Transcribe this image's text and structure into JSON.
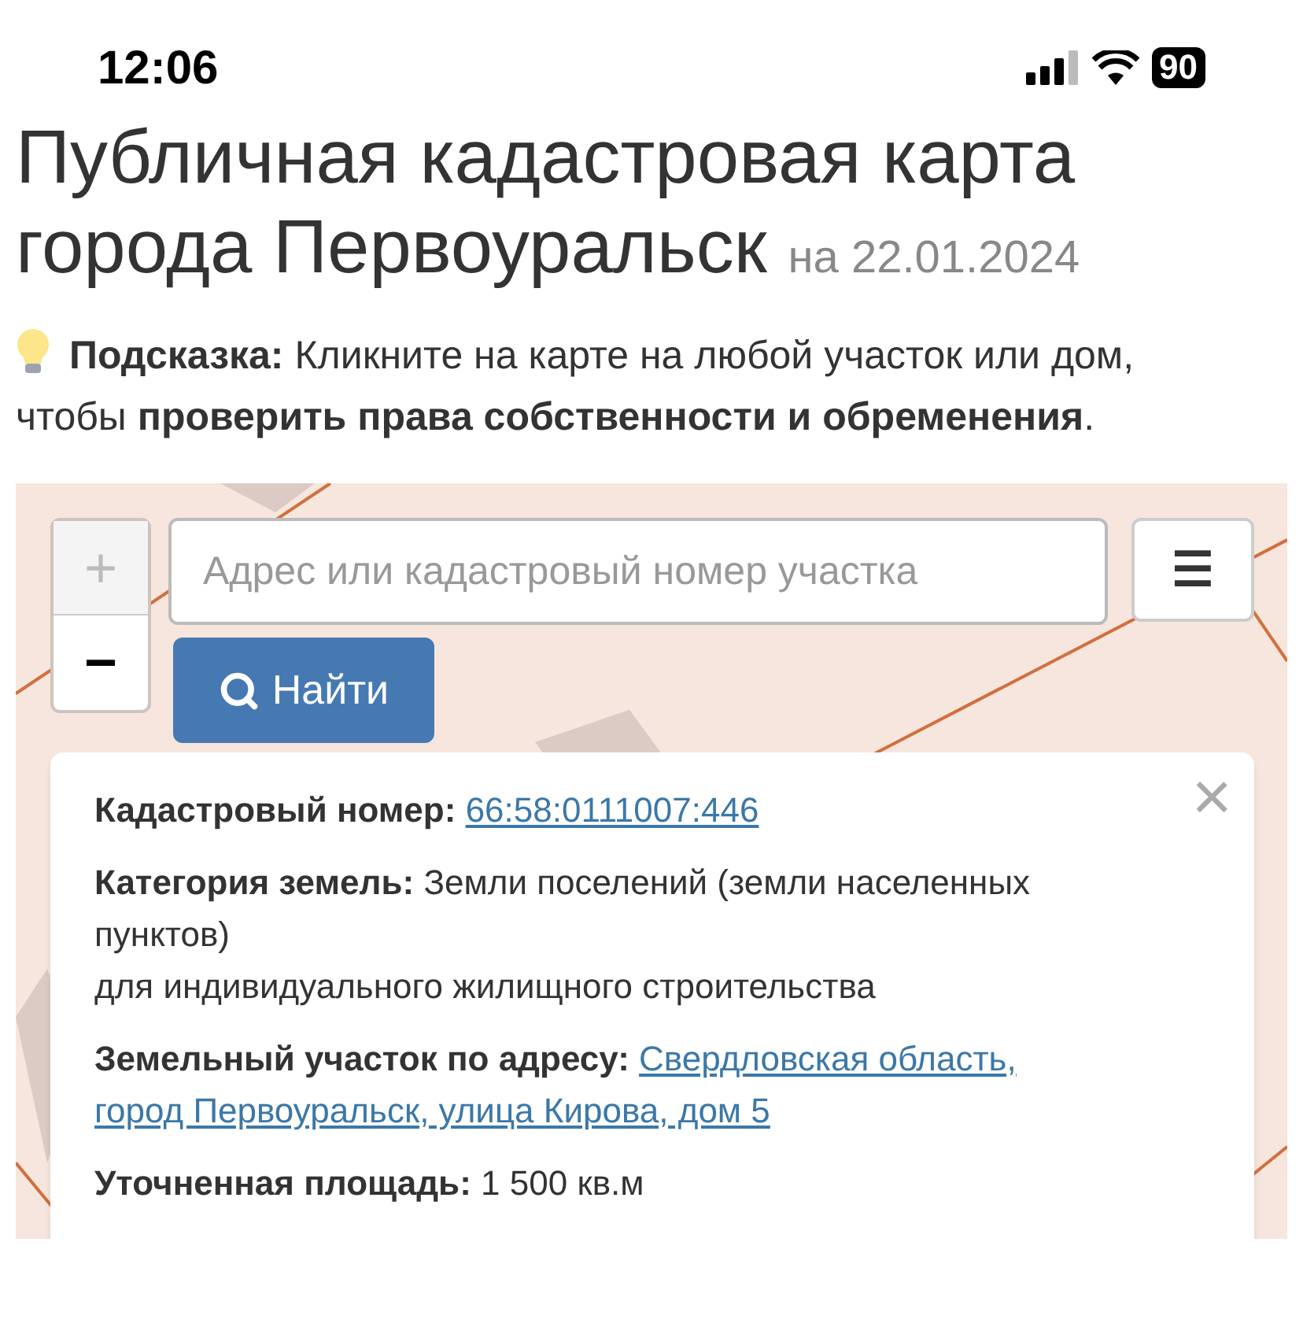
{
  "status_bar": {
    "time": "12:06",
    "battery": "90"
  },
  "title": {
    "text": "Публичная кадастровая карта города Первоуральск",
    "date": "на 22.01.2024"
  },
  "hint": {
    "label": "Подсказка:",
    "text": "Кликните на карте на любой участок или дом, чтобы **проверить права собственности и обременения**."
  },
  "map": {
    "zoom_in": "+",
    "zoom_out": "−",
    "search": {
      "placeholder": "Адрес или кадастровый номер участка"
    },
    "find_button": "Найти",
    "menu_button": "☰",
    "popup": {
      "close": "×",
      "fields": [
        {
          "label": "Кадастровый номер:",
          "value": "66:58:0111007:446",
          "kind": "link"
        },
        {
          "label": "Категория земель:",
          "value": "Земли поселений (земли населенных пунктов)",
          "extra": "для индивидуального жилищного строительства",
          "kind": "text"
        },
        {
          "label": "Земельный участок по адресу:",
          "value": "Свердловская область,",
          "more_links": [
            "город Первоуральск, улица Кирова, дом 5"
          ],
          "kind": "link"
        },
        {
          "label": "Уточненная площадь:",
          "value": "1 500 кв.м",
          "kind": "text"
        }
      ]
    }
  }
}
